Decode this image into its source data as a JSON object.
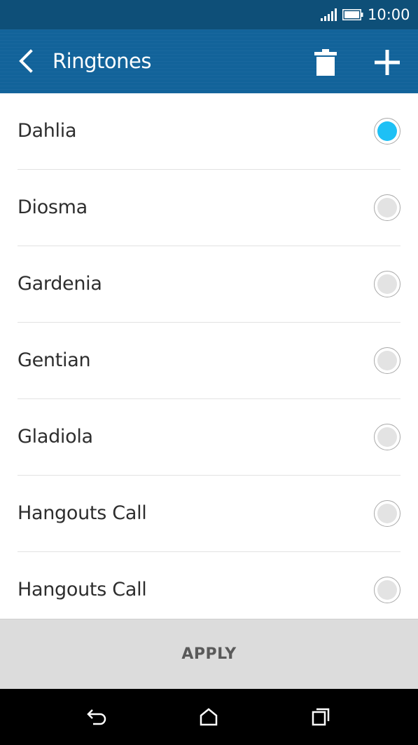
{
  "status_bar": {
    "time": "10:00",
    "icons": [
      "signal-icon",
      "battery-icon"
    ]
  },
  "app_bar": {
    "title": "Ringtones",
    "icons": [
      "back-arrow-icon",
      "trash-icon",
      "plus-icon"
    ]
  },
  "ringtones": {
    "items": [
      {
        "label": "Dahlia",
        "selected": true
      },
      {
        "label": "Diosma",
        "selected": false
      },
      {
        "label": "Gardenia",
        "selected": false
      },
      {
        "label": "Gentian",
        "selected": false
      },
      {
        "label": "Gladiola",
        "selected": false
      },
      {
        "label": "Hangouts Call",
        "selected": false
      },
      {
        "label": "Hangouts Call",
        "selected": false
      }
    ]
  },
  "apply": {
    "label": "APPLY"
  },
  "nav_bar": {
    "icons": [
      "back-icon",
      "home-icon",
      "recents-icon"
    ]
  },
  "colors": {
    "status_bar": "#0e4f78",
    "app_bar": "#12639a",
    "accent": "#1ec0f5",
    "apply_bar": "#dcdcdc"
  }
}
